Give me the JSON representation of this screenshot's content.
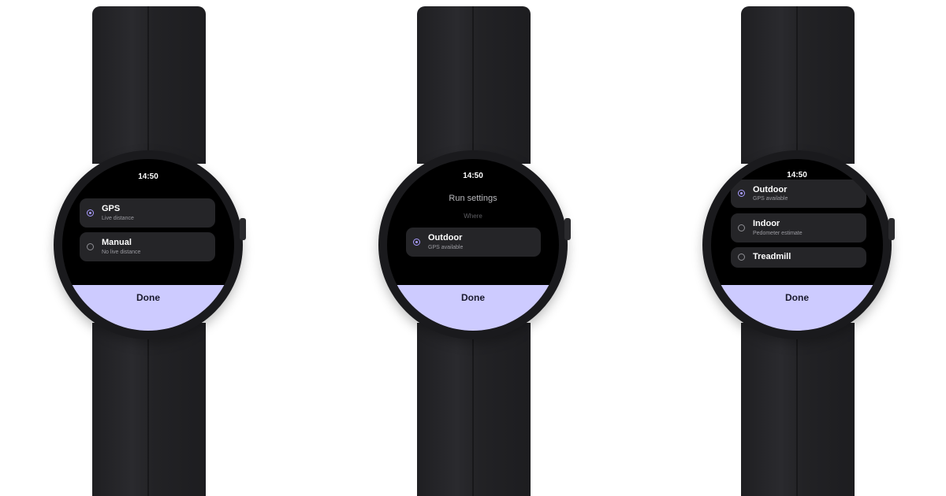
{
  "screens": [
    {
      "time": "14:50",
      "options": [
        {
          "label": "GPS",
          "secondary": "Live distance",
          "selected": true
        },
        {
          "label": "Manual",
          "secondary": "No live distance",
          "selected": false
        }
      ],
      "done_label": "Done"
    },
    {
      "time": "14:50",
      "title": "Run settings",
      "section": "Where",
      "options": [
        {
          "label": "Outdoor",
          "secondary": "GPS available",
          "selected": true
        }
      ],
      "done_label": "Done"
    },
    {
      "time": "14:50",
      "options": [
        {
          "label": "Outdoor",
          "secondary": "GPS available",
          "selected": true
        },
        {
          "label": "Indoor",
          "secondary": "Pedometer estimate",
          "selected": false
        },
        {
          "label": "Treadmill",
          "selected": false
        }
      ],
      "done_label": "Done"
    }
  ],
  "colors": {
    "accent": "#a99cff",
    "done_button": "#cdcbff",
    "chip": "#252528",
    "screen": "#000000",
    "strap": "#222225"
  },
  "icons": [
    "radio-selected-icon",
    "radio-unselected-icon"
  ]
}
